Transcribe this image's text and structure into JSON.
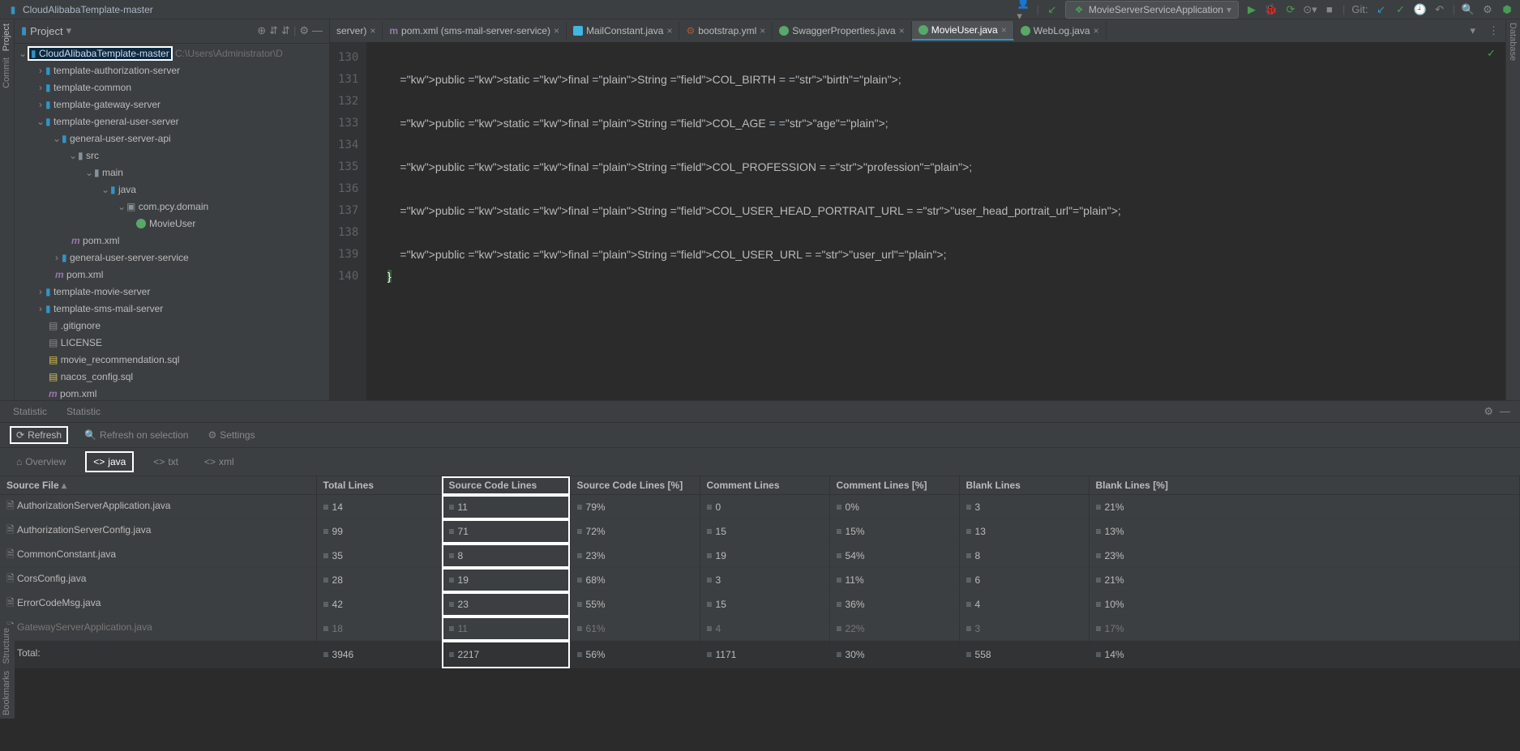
{
  "window_title": "CloudAlibabaTemplate-master",
  "topbar": {
    "run_config": "MovieServerServiceApplication",
    "git_label": "Git:"
  },
  "project_panel": {
    "header": "Project",
    "root_name": "CloudAlibabaTemplate-master",
    "root_path": "C:\\Users\\Administrator\\D",
    "nodes": {
      "authz": "template-authorization-server",
      "common": "template-common",
      "gateway": "template-gateway-server",
      "general_user": "template-general-user-server",
      "gu_api": "general-user-server-api",
      "src": "src",
      "main": "main",
      "java": "java",
      "pkg": "com.pcy.domain",
      "movieuser": "MovieUser",
      "pom1": "pom.xml",
      "gu_service": "general-user-server-service",
      "pom2": "pom.xml",
      "movie_server": "template-movie-server",
      "sms_mail": "template-sms-mail-server",
      "gitignore": ".gitignore",
      "license": "LICENSE",
      "sql1": "movie_recommendation.sql",
      "sql2": "nacos_config.sql",
      "pom3": "pom.xml"
    }
  },
  "editor_tabs": [
    {
      "label": "server)",
      "type": "generic",
      "active": false
    },
    {
      "label": "pom.xml (sms-mail-server-service)",
      "type": "m",
      "active": false
    },
    {
      "label": "MailConstant.java",
      "type": "j",
      "active": false
    },
    {
      "label": "bootstrap.yml",
      "type": "y",
      "active": false
    },
    {
      "label": "SwaggerProperties.java",
      "type": "c",
      "active": false
    },
    {
      "label": "MovieUser.java",
      "type": "c",
      "active": true
    },
    {
      "label": "WebLog.java",
      "type": "c",
      "active": false
    }
  ],
  "code": {
    "lines": [
      {
        "n": 130,
        "t": ""
      },
      {
        "n": 131,
        "t": "    public static final String COL_BIRTH = \"birth\";"
      },
      {
        "n": 132,
        "t": ""
      },
      {
        "n": 133,
        "t": "    public static final String COL_AGE = \"age\";"
      },
      {
        "n": 134,
        "t": ""
      },
      {
        "n": 135,
        "t": "    public static final String COL_PROFESSION = \"profession\";"
      },
      {
        "n": 136,
        "t": ""
      },
      {
        "n": 137,
        "t": "    public static final String COL_USER_HEAD_PORTRAIT_URL = \"user_head_portrait_url\";"
      },
      {
        "n": 138,
        "t": ""
      },
      {
        "n": 139,
        "t": "    public static final String COL_USER_URL = \"user_url\";"
      },
      {
        "n": 140,
        "t": "}"
      }
    ]
  },
  "bottom": {
    "panel_tabs": [
      "Statistic",
      "Statistic"
    ],
    "toolbar": {
      "refresh": "Refresh",
      "refresh_sel": "Refresh on selection",
      "settings": "Settings"
    },
    "filters": [
      "Overview",
      "java",
      "txt",
      "xml"
    ],
    "columns": [
      "Source File",
      "Total Lines",
      "Source Code Lines",
      "Source Code Lines [%]",
      "Comment Lines",
      "Comment Lines [%]",
      "Blank Lines",
      "Blank Lines [%]"
    ],
    "rows": [
      {
        "f": "AuthorizationServerApplication.java",
        "tl": "14",
        "scl": "11",
        "sclp": "79%",
        "cl": "0",
        "clp": "0%",
        "bl": "3",
        "blp": "21%"
      },
      {
        "f": "AuthorizationServerConfig.java",
        "tl": "99",
        "scl": "71",
        "sclp": "72%",
        "cl": "15",
        "clp": "15%",
        "bl": "13",
        "blp": "13%"
      },
      {
        "f": "CommonConstant.java",
        "tl": "35",
        "scl": "8",
        "sclp": "23%",
        "cl": "19",
        "clp": "54%",
        "bl": "8",
        "blp": "23%"
      },
      {
        "f": "CorsConfig.java",
        "tl": "28",
        "scl": "19",
        "sclp": "68%",
        "cl": "3",
        "clp": "11%",
        "bl": "6",
        "blp": "21%"
      },
      {
        "f": "ErrorCodeMsg.java",
        "tl": "42",
        "scl": "23",
        "sclp": "55%",
        "cl": "15",
        "clp": "36%",
        "bl": "4",
        "blp": "10%"
      },
      {
        "f": "GatewayServerApplication.java",
        "tl": "18",
        "scl": "11",
        "sclp": "61%",
        "cl": "4",
        "clp": "22%",
        "bl": "3",
        "blp": "17%"
      }
    ],
    "total_label": "Total:",
    "total": {
      "tl": "3946",
      "scl": "2217",
      "sclp": "56%",
      "cl": "1171",
      "clp": "30%",
      "bl": "558",
      "blp": "14%"
    }
  },
  "left_sidebar": {
    "project": "Project",
    "commit": "Commit",
    "structure": "Structure",
    "bookmarks": "Bookmarks"
  },
  "right_sidebar": {
    "database": "Database"
  }
}
